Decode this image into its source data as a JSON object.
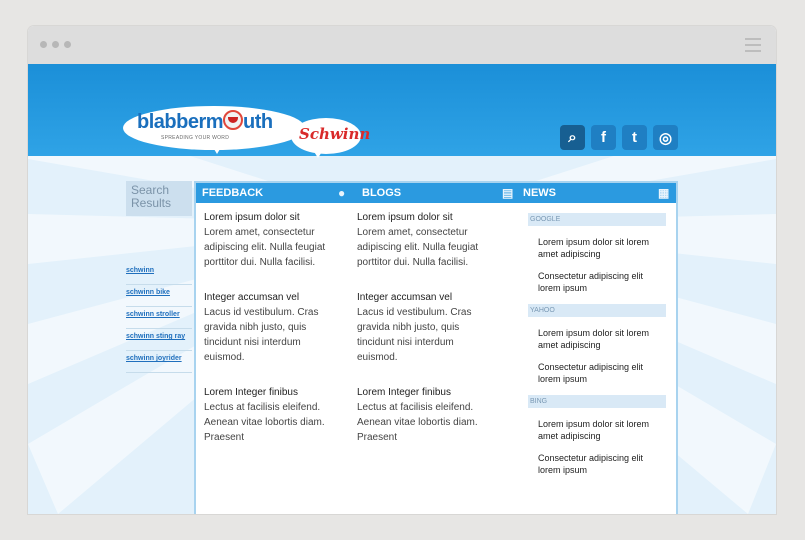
{
  "logo": {
    "text_start": "blabberm",
    "text_end": "uth",
    "tagline": "SPREADING YOUR WORD",
    "partner": "Schwinn"
  },
  "social": [
    {
      "icon": "search-icon",
      "glyph": "⌕"
    },
    {
      "icon": "facebook-icon",
      "glyph": "f"
    },
    {
      "icon": "twitter-icon",
      "glyph": "t"
    },
    {
      "icon": "globe-icon",
      "glyph": "◎"
    }
  ],
  "sidebar": {
    "title": "Search Results",
    "links": [
      "schwinn",
      "schwinn bike",
      "schwinn stroller",
      "schwinn sting ray",
      "schwinn joyrider"
    ]
  },
  "tabs": {
    "feedback": "FEEDBACK",
    "blogs": "BLOGS",
    "news": "NEWS"
  },
  "feedback": [
    {
      "title": "Lorem ipsum dolor sit",
      "body": "Lorem amet, consectetur adipiscing elit. Nulla feugiat porttitor dui. Nulla facilisi."
    },
    {
      "title": "Integer accumsan vel",
      "body": "Lacus id vestibulum. Cras gravida nibh justo, quis tincidunt nisi interdum euismod."
    },
    {
      "title": "Lorem Integer finibus",
      "body": "Lectus at facilisis eleifend. Aenean vitae lobortis diam. Praesent"
    }
  ],
  "blogs": [
    {
      "title": "Lorem ipsum dolor sit",
      "body": "Lorem amet, consectetur adipiscing elit. Nulla feugiat porttitor dui. Nulla facilisi."
    },
    {
      "title": "Integer accumsan vel",
      "body": "Lacus id vestibulum. Cras gravida nibh justo, quis tincidunt nisi interdum euismod."
    },
    {
      "title": "Lorem Integer finibus",
      "body": "Lectus at facilisis eleifend. Aenean vitae lobortis diam. Praesent"
    }
  ],
  "news": [
    {
      "source": "GOOGLE",
      "items": [
        "Lorem ipsum dolor sit lorem amet adipiscing",
        "Consectetur adipiscing elit lorem ipsum"
      ]
    },
    {
      "source": "YAHOO",
      "items": [
        "Lorem ipsum dolor sit lorem amet adipiscing",
        "Consectetur adipiscing elit lorem ipsum"
      ]
    },
    {
      "source": "BING",
      "items": [
        "Lorem ipsum dolor sit lorem amet adipiscing",
        "Consectetur adipiscing elit lorem ipsum"
      ]
    }
  ],
  "colors": {
    "header": "#2fa3e6",
    "panel_head": "#2b9ae0",
    "link": "#1f6fbd",
    "brand_red": "#d92a2a"
  }
}
